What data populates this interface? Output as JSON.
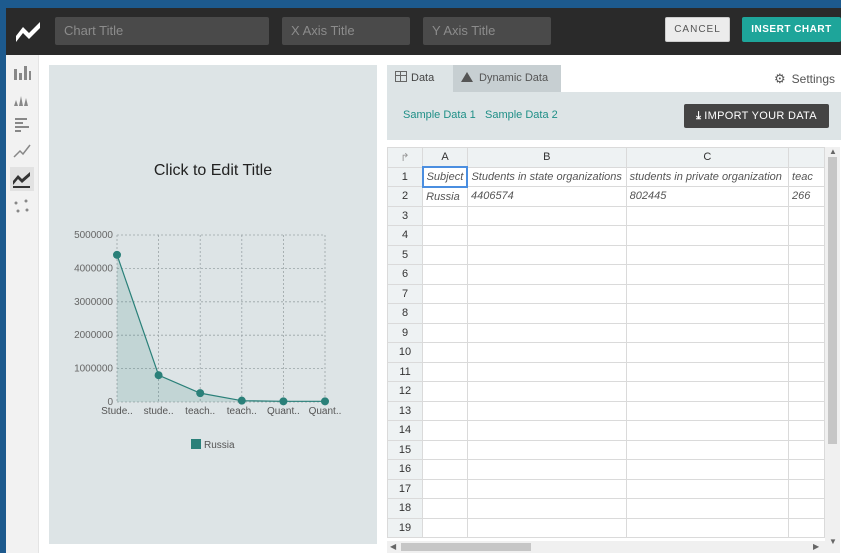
{
  "toolbar": {
    "chart_title_placeholder": "Chart Title",
    "x_axis_placeholder": "X Axis Title",
    "y_axis_placeholder": "Y Axis Title",
    "cancel_label": "CANCEL",
    "insert_label": "INSERT CHART"
  },
  "sidebar": {
    "items": [
      "bar-chart-icon",
      "histogram-icon",
      "horizontal-bar-icon",
      "line-chart-icon",
      "area-chart-icon",
      "scatter-icon"
    ],
    "active": "area-chart-icon"
  },
  "preview": {
    "title": "Click to Edit Title"
  },
  "chart_data": {
    "type": "area",
    "title": "Click to Edit Title",
    "categories": [
      "Stude..",
      "stude..",
      "teach..",
      "teach..",
      "Quant..",
      "Quant.."
    ],
    "series": [
      {
        "name": "Russia",
        "values": [
          4406574,
          802445,
          266000,
          40000,
          20000,
          20000
        ]
      }
    ],
    "yticks": [
      "5000000",
      "4000000",
      "3000000",
      "2000000",
      "1000000",
      "0"
    ],
    "ylim": [
      0,
      5000000
    ],
    "grid": true,
    "legend": "bottom",
    "color": "#2a8079"
  },
  "data_panel": {
    "tab_data": "Data",
    "tab_dynamic": "Dynamic Data",
    "settings": "Settings",
    "sample1": "Sample Data 1",
    "sample2": "Sample Data 2",
    "import": "IMPORT YOUR DATA"
  },
  "sheet": {
    "columns": [
      "A",
      "B",
      "C",
      ""
    ],
    "rows": [
      [
        "Subject",
        "Students in state organizations",
        "students in private organization",
        "teac"
      ],
      [
        "Russia",
        "4406574",
        "802445",
        "266"
      ]
    ],
    "row_count": 19
  }
}
